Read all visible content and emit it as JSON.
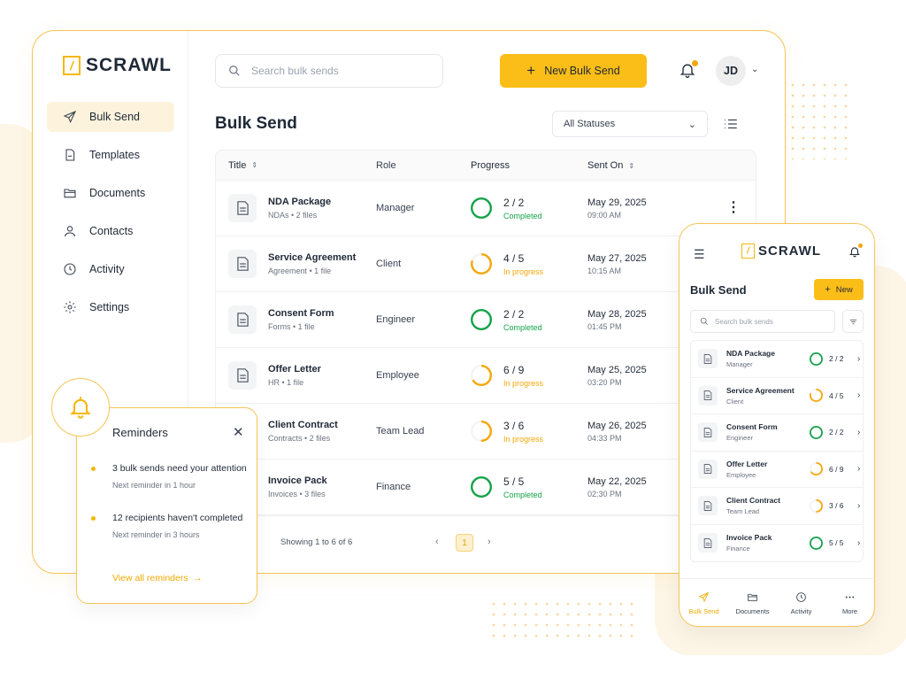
{
  "brand": {
    "name": "SCRAWL"
  },
  "colors": {
    "accent": "#fbbd18",
    "completed": "#16a34a",
    "in_progress": "#f5a70a",
    "border": "#f6c453"
  },
  "sidebar": {
    "items": [
      {
        "label": "Bulk Send",
        "icon": "send-icon",
        "active": true
      },
      {
        "label": "Templates",
        "icon": "template-icon",
        "active": false
      },
      {
        "label": "Documents",
        "icon": "folder-icon",
        "active": false
      },
      {
        "label": "Contacts",
        "icon": "contacts-icon",
        "active": false
      },
      {
        "label": "Activity",
        "icon": "clock-icon",
        "active": false
      },
      {
        "label": "Settings",
        "icon": "gear-icon",
        "active": false
      }
    ]
  },
  "header": {
    "search_placeholder": "Search bulk sends",
    "new_button": "New Bulk Send",
    "avatar_initials": "JD"
  },
  "main": {
    "title": "Bulk Send",
    "status_filter": "All Statuses",
    "columns": {
      "title": "Title",
      "role": "Role",
      "progress": "Progress",
      "sent_on": "Sent On"
    },
    "rows": [
      {
        "title": "NDA Package",
        "meta": "NDAs  •  2 files",
        "role": "Manager",
        "done": 2,
        "total": 2,
        "count": "2 / 2",
        "status": "Completed",
        "date": "May 29, 2025",
        "time": "09:00 AM"
      },
      {
        "title": "Service Agreement",
        "meta": "Agreement  •  1 file",
        "role": "Client",
        "done": 4,
        "total": 5,
        "count": "4 / 5",
        "status": "In progress",
        "date": "May 27, 2025",
        "time": "10:15 AM"
      },
      {
        "title": "Consent Form",
        "meta": "Forms  •  1 file",
        "role": "Engineer",
        "done": 2,
        "total": 2,
        "count": "2 / 2",
        "status": "Completed",
        "date": "May 28, 2025",
        "time": "01:45 PM"
      },
      {
        "title": "Offer Letter",
        "meta": "HR  •  1 file",
        "role": "Employee",
        "done": 6,
        "total": 9,
        "count": "6 / 9",
        "status": "In progress",
        "date": "May 25, 2025",
        "time": "03:20 PM"
      },
      {
        "title": "Client Contract",
        "meta": "Contracts  •  2 files",
        "role": "Team Lead",
        "done": 3,
        "total": 6,
        "count": "3 / 6",
        "status": "In progress",
        "date": "May 26, 2025",
        "time": "04:33 PM"
      },
      {
        "title": "Invoice Pack",
        "meta": "Invoices  •  3 files",
        "role": "Finance",
        "done": 5,
        "total": 5,
        "count": "5 / 5",
        "status": "Completed",
        "date": "May 22, 2025",
        "time": "02:30 PM"
      }
    ],
    "pagination": {
      "summary": "Showing 1 to 6 of 6",
      "current": "1"
    }
  },
  "reminders": {
    "title": "Reminders",
    "items": [
      {
        "text": "3 bulk sends need your attention",
        "sub": "Next reminder in 1 hour"
      },
      {
        "text": "12 recipients haven't completed",
        "sub": "Next reminder in 3 hours"
      }
    ],
    "link": "View all reminders"
  },
  "mobile": {
    "title": "Bulk Send",
    "new_button": "New",
    "search_placeholder": "Search bulk sends",
    "tabs": [
      {
        "label": "Bulk Send",
        "icon": "send-icon",
        "active": true
      },
      {
        "label": "Documents",
        "icon": "folder-icon",
        "active": false
      },
      {
        "label": "Activity",
        "icon": "clock-icon",
        "active": false
      },
      {
        "label": "More",
        "icon": "more-icon",
        "active": false
      }
    ]
  }
}
